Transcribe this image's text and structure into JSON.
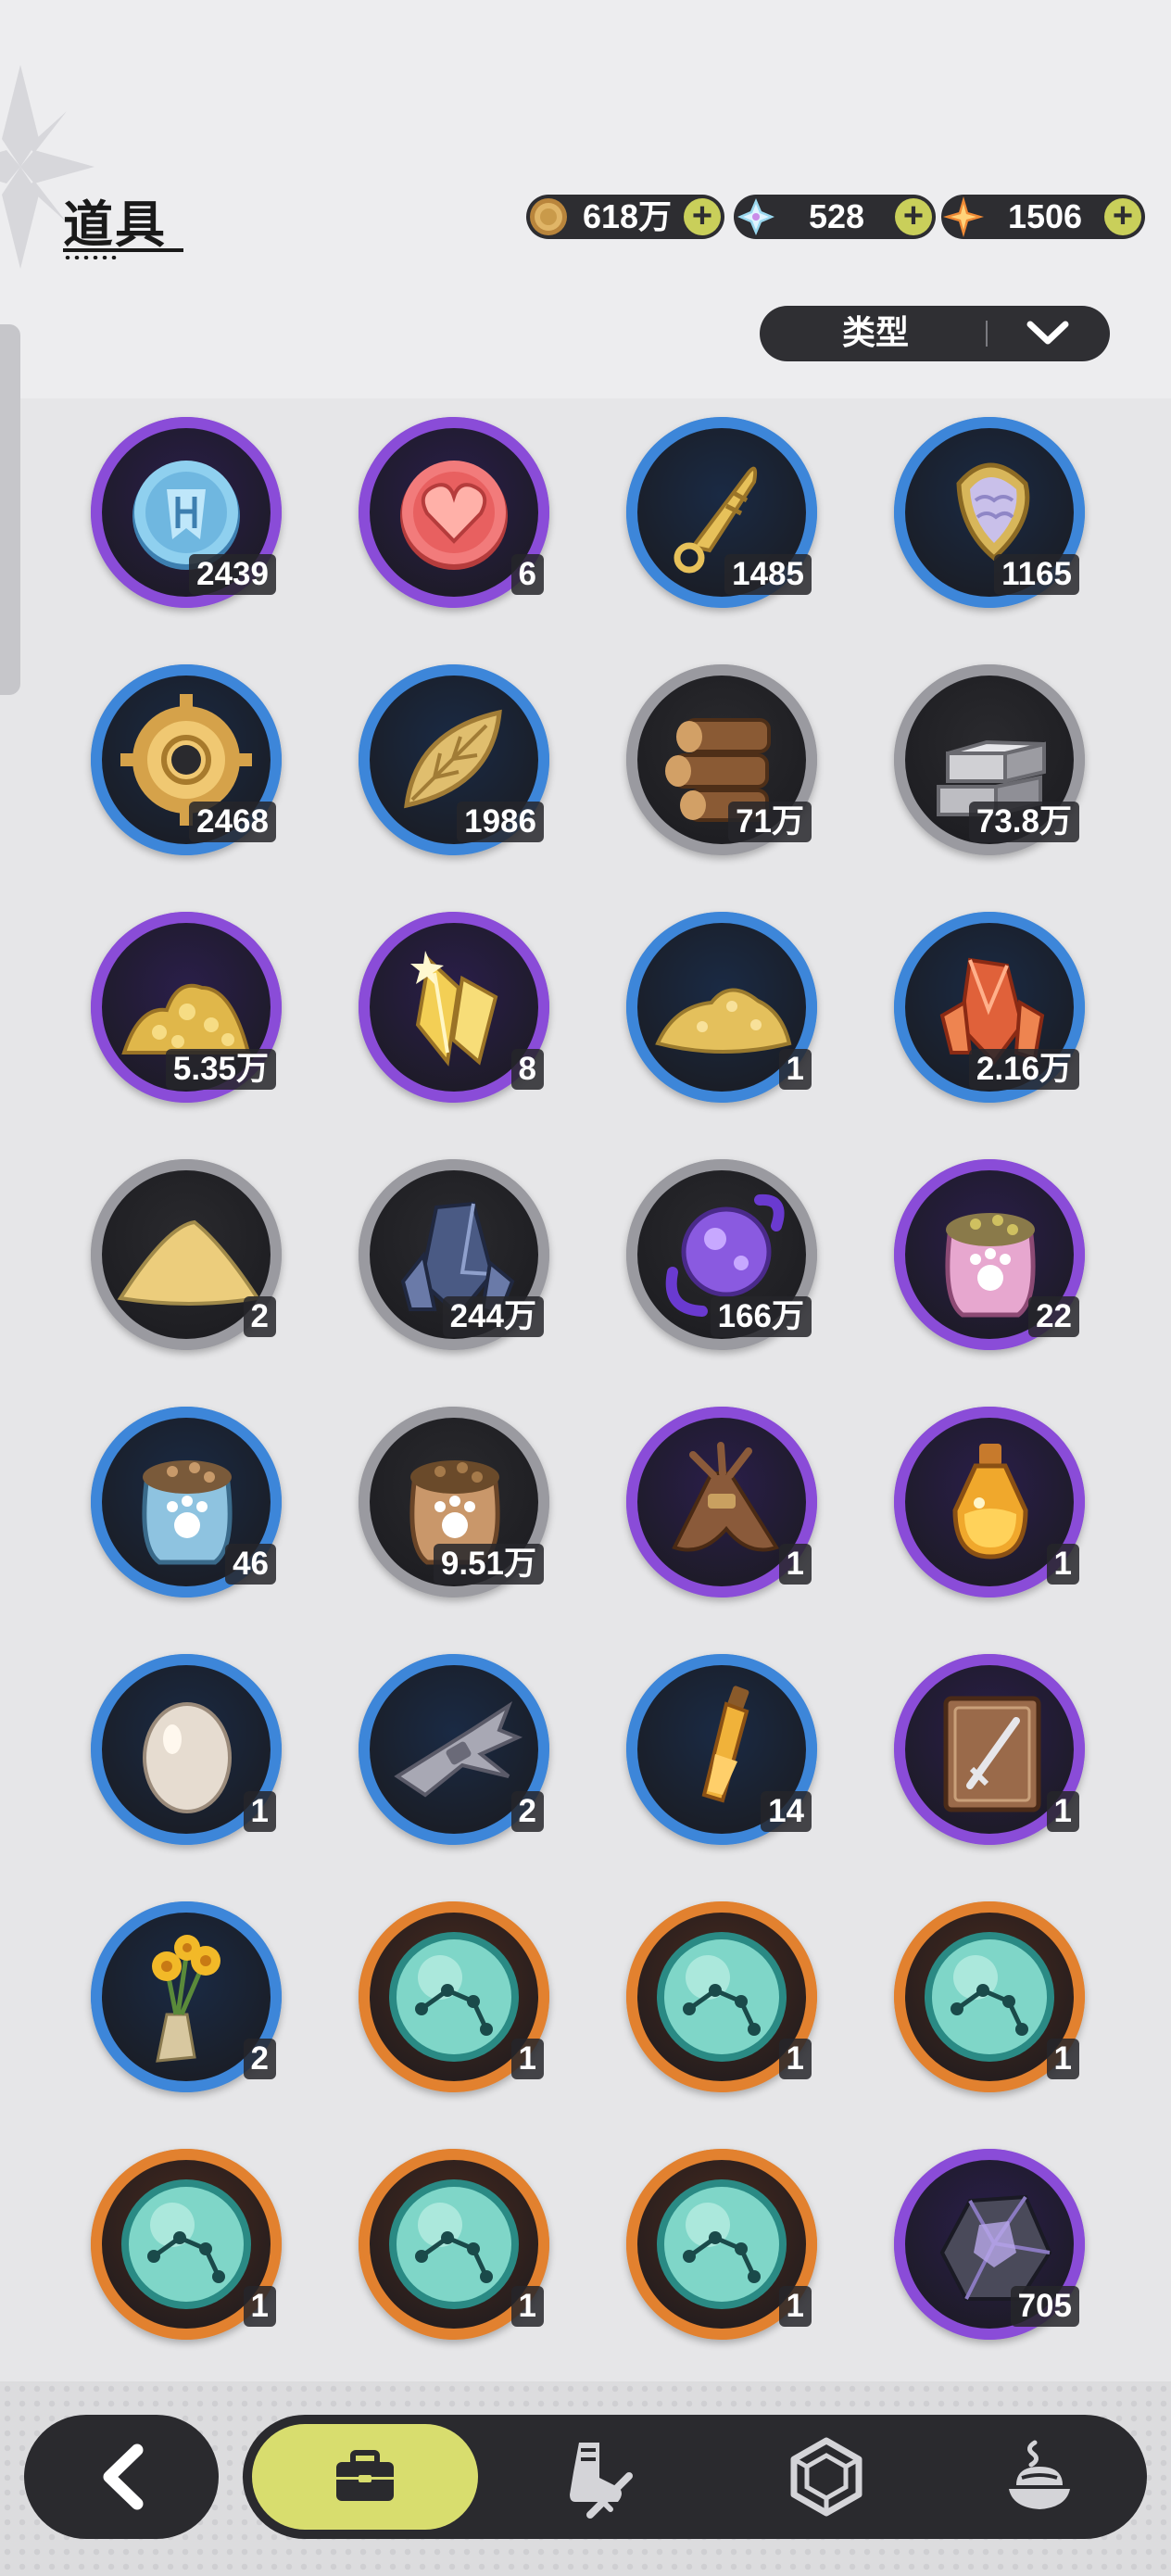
{
  "header": {
    "title": "道具"
  },
  "currencies": [
    {
      "name": "gold-coin",
      "value": "618万",
      "color": "#c99a4a"
    },
    {
      "name": "crystal",
      "value": "528",
      "color": "#8fd7e8"
    },
    {
      "name": "star-shard",
      "value": "1506",
      "color": "#f09040"
    }
  ],
  "filter": {
    "label": "类型"
  },
  "items": [
    {
      "icon": "blue-emblem-coin-icon",
      "qty": "2439",
      "rarity": "purple"
    },
    {
      "icon": "heart-coin-icon",
      "qty": "6",
      "rarity": "purple"
    },
    {
      "icon": "golden-key-icon",
      "qty": "1485",
      "rarity": "blue"
    },
    {
      "icon": "scale-amulet-icon",
      "qty": "1165",
      "rarity": "blue"
    },
    {
      "icon": "gear-coin-icon",
      "qty": "2468",
      "rarity": "blue"
    },
    {
      "icon": "golden-leaf-icon",
      "qty": "1986",
      "rarity": "blue"
    },
    {
      "icon": "wood-logs-icon",
      "qty": "71万",
      "rarity": "gray"
    },
    {
      "icon": "stone-bricks-icon",
      "qty": "73.8万",
      "rarity": "gray"
    },
    {
      "icon": "gold-ore-pile-icon",
      "qty": "5.35万",
      "rarity": "purple"
    },
    {
      "icon": "gold-crystal-icon",
      "qty": "8",
      "rarity": "purple"
    },
    {
      "icon": "gold-sand-pile-icon",
      "qty": "1",
      "rarity": "blue"
    },
    {
      "icon": "red-crystal-icon",
      "qty": "2.16万",
      "rarity": "blue"
    },
    {
      "icon": "sand-pile-icon",
      "qty": "2",
      "rarity": "gray"
    },
    {
      "icon": "dark-crystal-icon",
      "qty": "244万",
      "rarity": "gray"
    },
    {
      "icon": "purple-orb-icon",
      "qty": "166万",
      "rarity": "gray"
    },
    {
      "icon": "pink-feed-bag-icon",
      "qty": "22",
      "rarity": "purple"
    },
    {
      "icon": "blue-feed-bag-icon",
      "qty": "46",
      "rarity": "blue"
    },
    {
      "icon": "brown-feed-bag-icon",
      "qty": "9.51万",
      "rarity": "gray"
    },
    {
      "icon": "hay-bundle-icon",
      "qty": "1",
      "rarity": "purple"
    },
    {
      "icon": "golden-potion-icon",
      "qty": "1",
      "rarity": "purple"
    },
    {
      "icon": "egg-icon",
      "qty": "1",
      "rarity": "blue"
    },
    {
      "icon": "gray-herb-bundle-icon",
      "qty": "2",
      "rarity": "blue"
    },
    {
      "icon": "amber-vial-icon",
      "qty": "14",
      "rarity": "blue"
    },
    {
      "icon": "sword-book-icon",
      "qty": "1",
      "rarity": "purple"
    },
    {
      "icon": "flower-bouquet-icon",
      "qty": "2",
      "rarity": "blue"
    },
    {
      "icon": "constellation-orb-icon",
      "qty": "1",
      "rarity": "orange"
    },
    {
      "icon": "constellation-orb-icon",
      "qty": "1",
      "rarity": "orange"
    },
    {
      "icon": "constellation-orb-icon",
      "qty": "1",
      "rarity": "orange"
    },
    {
      "icon": "constellation-orb-icon",
      "qty": "1",
      "rarity": "orange"
    },
    {
      "icon": "constellation-orb-icon",
      "qty": "1",
      "rarity": "orange"
    },
    {
      "icon": "constellation-orb-icon",
      "qty": "1",
      "rarity": "orange"
    },
    {
      "icon": "amethyst-stone-icon",
      "qty": "705",
      "rarity": "purple"
    }
  ],
  "rarity_colors": {
    "purple": "#8a4cd8",
    "blue": "#3d86d9",
    "gray": "#9a9aa0",
    "orange": "#e2812f"
  },
  "nav": {
    "back": "back-arrow-icon",
    "tabs": [
      {
        "icon": "briefcase-icon",
        "active": true
      },
      {
        "icon": "boot-sword-icon",
        "active": false
      },
      {
        "icon": "hexagon-gem-icon",
        "active": false
      },
      {
        "icon": "food-dish-icon",
        "active": false
      }
    ],
    "active_color": "#d8dd6e"
  }
}
